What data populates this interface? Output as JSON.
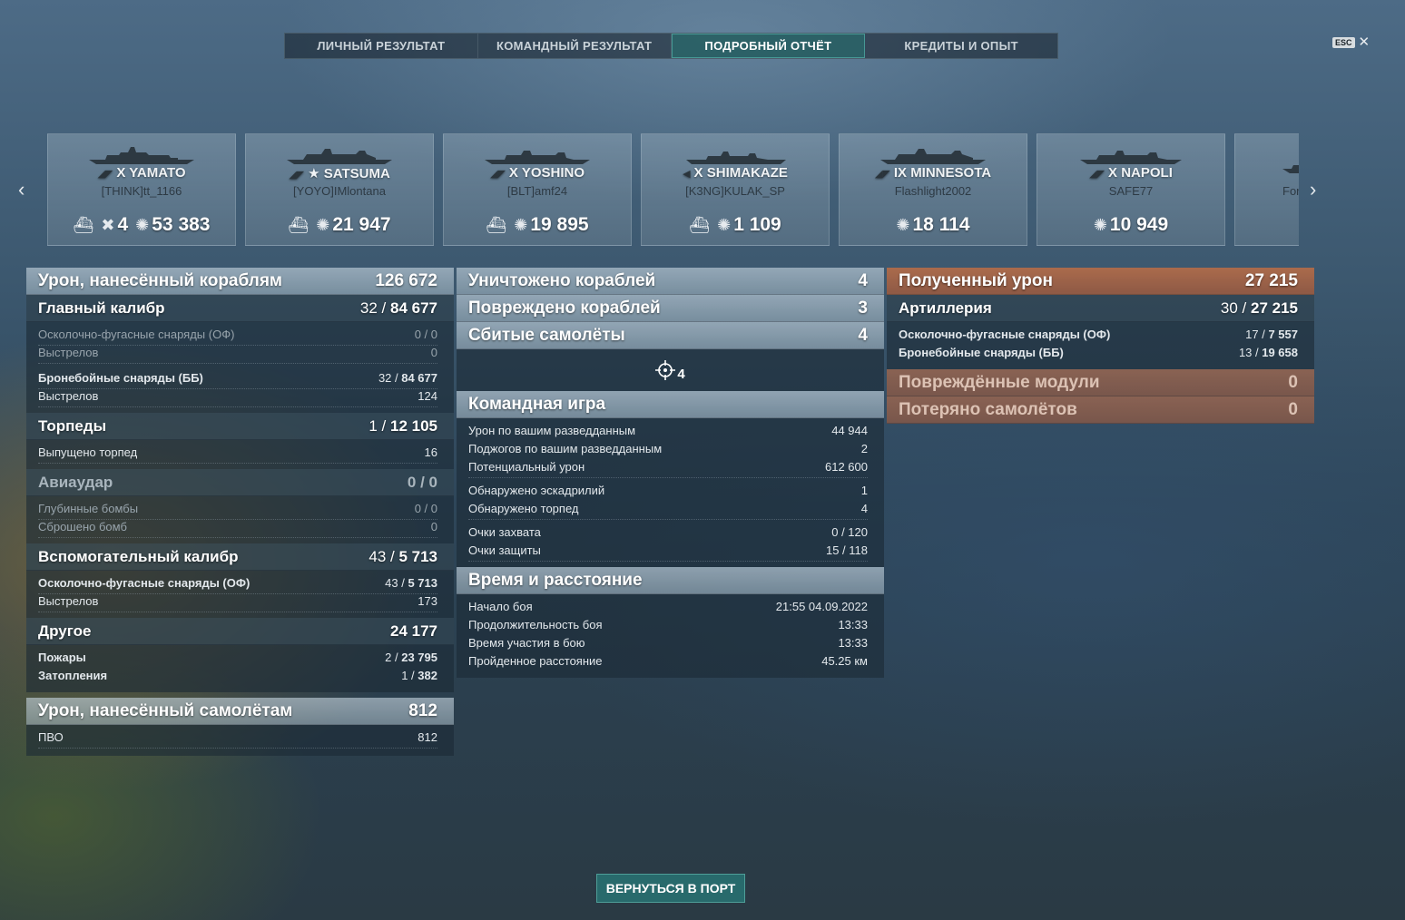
{
  "tabs": [
    "ЛИЧНЫЙ РЕЗУЛЬТАТ",
    "КОМАНДНЫЙ РЕЗУЛЬТАТ",
    "ПОДРОБНЫЙ ОТЧЁТ",
    "КРЕДИТЫ И ОПЫТ"
  ],
  "active_tab": 2,
  "esc_label": "ESC",
  "ships": [
    {
      "tier": "X",
      "name": "YAMATO",
      "player": "[THINK]tt_1166",
      "kills": "4",
      "damage": "53 383"
    },
    {
      "tier": "★",
      "name": "SATSUMA",
      "player": "[YOYO]IMlontana",
      "damage": "21 947"
    },
    {
      "tier": "X",
      "name": "YOSHINO",
      "player": "[BLT]amf24",
      "damage": "19 895"
    },
    {
      "tier": "X",
      "name": "SHIMAKAZE",
      "player": "[K3NG]KULAK_SP",
      "damage": "1 109"
    },
    {
      "tier": "IX",
      "name": "MINNESOTA",
      "player": "Flashlight2002",
      "damage": "18 114"
    },
    {
      "tier": "X",
      "name": "NAPOLI",
      "player": "SAFE77",
      "damage": "10 949"
    },
    {
      "tier": "",
      "name": "",
      "player": "For",
      "damage": ""
    }
  ],
  "left": {
    "ship_damage": {
      "label": "Урон, нанесённый кораблям",
      "value": "126 672"
    },
    "main_battery": {
      "label": "Главный калибр",
      "hits": "32 / ",
      "dmg": "84 677"
    },
    "mb_he": {
      "label": "Осколочно-фугасные снаряды (ОФ)",
      "value": "0 / 0"
    },
    "mb_he_shots": {
      "label": "Выстрелов",
      "value": "0"
    },
    "mb_ap": {
      "label": "Бронебойные снаряды (ББ)",
      "hits": "32 / ",
      "dmg": "84 677"
    },
    "mb_ap_shots": {
      "label": "Выстрелов",
      "value": "124"
    },
    "torpedoes": {
      "label": "Торпеды",
      "hits": "1 / ",
      "dmg": "12 105"
    },
    "torp_launched": {
      "label": "Выпущено торпед",
      "value": "16"
    },
    "airstrike": {
      "label": "Авиаудар",
      "value": "0 / 0"
    },
    "depth_charges": {
      "label": "Глубинные бомбы",
      "value": "0 / 0"
    },
    "bombs_dropped": {
      "label": "Сброшено бомб",
      "value": "0"
    },
    "secondary": {
      "label": "Вспомогательный калибр",
      "hits": "43 / ",
      "dmg": "5 713"
    },
    "sec_he": {
      "label": "Осколочно-фугасные снаряды (ОФ)",
      "hits": "43 / ",
      "dmg": "5 713"
    },
    "sec_shots": {
      "label": "Выстрелов",
      "value": "173"
    },
    "other": {
      "label": "Другое",
      "value": "24 177"
    },
    "fires": {
      "label": "Пожары",
      "hits": "2 / ",
      "dmg": "23 795"
    },
    "floods": {
      "label": "Затопления",
      "hits": "1 / ",
      "dmg": "382"
    },
    "plane_damage": {
      "label": "Урон, нанесённый самолётам",
      "value": "812"
    },
    "aa": {
      "label": "ПВО",
      "value": "812"
    }
  },
  "middle": {
    "destroyed": {
      "label": "Уничтожено кораблей",
      "value": "4"
    },
    "damaged": {
      "label": "Повреждено кораблей",
      "value": "3"
    },
    "planes_shot": {
      "label": "Сбитые самолёты",
      "value": "4"
    },
    "crosshair_count": "4",
    "team_title": "Командная игра",
    "spot_damage": {
      "label": "Урон по вашим разведданным",
      "value": "44 944"
    },
    "spot_fires": {
      "label": "Поджогов по вашим разведданным",
      "value": "2"
    },
    "potential": {
      "label": "Потенциальный урон",
      "value": "612 600"
    },
    "squadrons": {
      "label": "Обнаружено эскадрилий",
      "value": "1"
    },
    "torps_spotted": {
      "label": "Обнаружено торпед",
      "value": "4"
    },
    "capture": {
      "label": "Очки захвата",
      "value": "0 / 120"
    },
    "defense": {
      "label": "Очки защиты",
      "value": "15 / 118"
    },
    "time_title": "Время и расстояние",
    "start": {
      "label": "Начало боя",
      "value": "21:55  04.09.2022"
    },
    "duration": {
      "label": "Продолжительность боя",
      "value": "13:33"
    },
    "participation": {
      "label": "Время участия в бою",
      "value": "13:33"
    },
    "distance": {
      "label": "Пройденное расстояние",
      "value": "45.25 км"
    }
  },
  "right": {
    "received": {
      "label": "Полученный урон",
      "value": "27 215"
    },
    "artillery": {
      "label": "Артиллерия",
      "hits": "30 / ",
      "dmg": "27 215"
    },
    "art_he": {
      "label": "Осколочно-фугасные снаряды (ОФ)",
      "hits": "17 / ",
      "dmg": "7 557"
    },
    "art_ap": {
      "label": "Бронебойные снаряды (ББ)",
      "hits": "13 / ",
      "dmg": "19 658"
    },
    "modules": {
      "label": "Повреждённые модули",
      "value": "0"
    },
    "planes_lost": {
      "label": "Потеряно самолётов",
      "value": "0"
    }
  },
  "return_button": "ВЕРНУТЬСЯ В ПОРТ"
}
